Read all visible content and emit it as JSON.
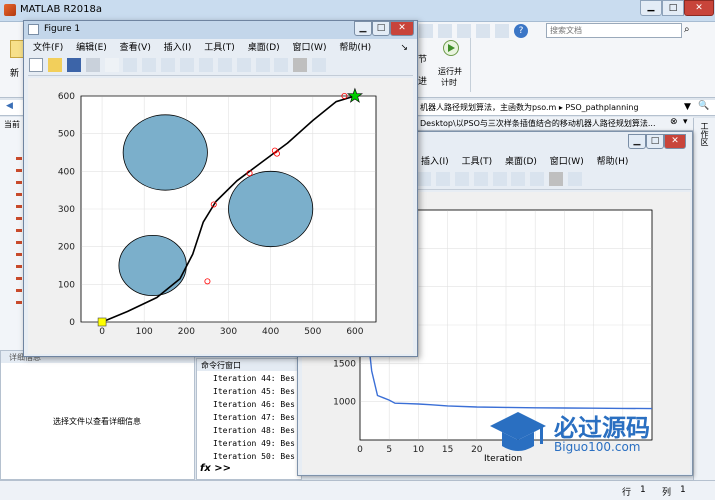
{
  "matlab": {
    "title": "MATLAB R2018a",
    "search_placeholder": "搜索文档",
    "toolstrip": {
      "new_label": "新",
      "run_advance": "节",
      "run_time_label": "运行并\n计时",
      "run_time_line1": "运行并",
      "run_time_line2": "计时",
      "advance_label": "进"
    },
    "address_path": "机器人路径规划算法，主函数为pso.m ▸ PSO_pathplanning",
    "second_path": "Desktop\\以PSO与三次样条插值结合的移动机器人路径规划算法...",
    "current_folder_label": "当前",
    "workspace_label": "工作区",
    "details_title": "详细信息",
    "details_message": "选择文件以查看详细信息",
    "command_window_title": "命令行窗口",
    "command_lines": [
      "Iteration 44: Bes",
      "Iteration 45: Bes",
      "Iteration 46: Bes",
      "Iteration 47: Bes",
      "Iteration 48: Bes",
      "Iteration 49: Bes",
      "Iteration 50: Bes"
    ],
    "prompt_symbol": "fx >>",
    "status": {
      "row_label": "行",
      "row_value": "1",
      "col_label": "列",
      "col_value": "1"
    }
  },
  "figure1": {
    "title": "Figure 1",
    "menu": [
      "文件(F)",
      "编辑(E)",
      "查看(V)",
      "插入(I)",
      "工具(T)",
      "桌面(D)",
      "窗口(W)",
      "帮助(H)"
    ],
    "chart_data": {
      "type": "scatter",
      "xlim": [
        -50,
        650
      ],
      "ylim": [
        0,
        600
      ],
      "xticks": [
        0,
        100,
        200,
        300,
        400,
        500,
        600
      ],
      "yticks": [
        0,
        100,
        200,
        300,
        400,
        500,
        600
      ],
      "grid": true,
      "obstacles": [
        {
          "cx": 150,
          "cy": 450,
          "r": 100
        },
        {
          "cx": 400,
          "cy": 300,
          "r": 100
        },
        {
          "cx": 120,
          "cy": 150,
          "r": 80
        }
      ],
      "obstacle_color": "#7bafcb",
      "path": [
        [
          0,
          0
        ],
        [
          60,
          28
        ],
        [
          130,
          65
        ],
        [
          185,
          115
        ],
        [
          215,
          180
        ],
        [
          240,
          265
        ],
        [
          270,
          320
        ],
        [
          320,
          375
        ],
        [
          380,
          425
        ],
        [
          440,
          475
        ],
        [
          500,
          535
        ],
        [
          555,
          585
        ],
        [
          600,
          600
        ]
      ],
      "path_color": "#000000",
      "waypoints": [
        [
          250,
          108
        ],
        [
          265,
          312
        ],
        [
          350,
          395
        ],
        [
          410,
          455
        ],
        [
          415,
          447
        ],
        [
          575,
          600
        ]
      ],
      "waypoint_color": "#ff0000",
      "start": {
        "x": 0,
        "y": 0,
        "marker": "square",
        "color": "#ffff00"
      },
      "goal": {
        "x": 600,
        "y": 600,
        "marker": "star",
        "color": "#00cc00"
      }
    }
  },
  "figure2": {
    "menu": [
      "插入(I)",
      "工具(T)",
      "桌面(D)",
      "窗口(W)",
      "帮助(H)"
    ],
    "chart_data": {
      "type": "line",
      "xlabel": "Iteration",
      "xlim": [
        0,
        50
      ],
      "ylim": [
        500,
        3500
      ],
      "xticks": [
        0,
        5,
        10,
        15,
        20
      ],
      "yticks": [
        1000,
        1500
      ],
      "ytick_labels": [
        "1000",
        "1500"
      ],
      "grid": true,
      "x": [
        0,
        1,
        2,
        3,
        4,
        5,
        6,
        8,
        10,
        12,
        15,
        20,
        25,
        30,
        35,
        40,
        45,
        50
      ],
      "y": [
        3500,
        2100,
        1400,
        1080,
        1050,
        1020,
        980,
        975,
        970,
        960,
        945,
        930,
        925,
        920,
        918,
        915,
        912,
        910
      ],
      "line_color": "#3b6fd6"
    }
  },
  "watermark": {
    "brand": "必过源码",
    "url": "Biguo100.com"
  }
}
